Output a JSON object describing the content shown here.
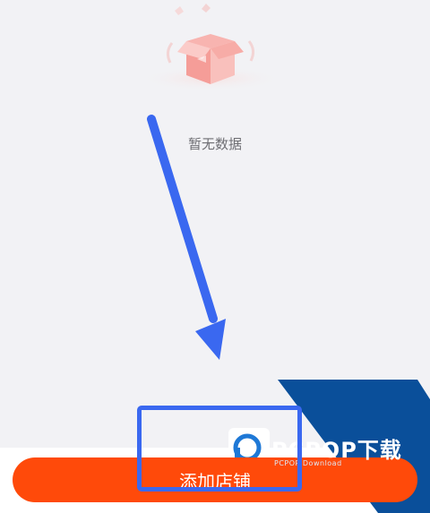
{
  "empty_state": {
    "text": "暂无数据",
    "illustration_icon": "empty-box-icon"
  },
  "actions": {
    "add_store_label": "添加店铺",
    "button_color": "#ff4a0a"
  },
  "annotation": {
    "arrow_color": "#3a68f0",
    "highlight_color": "#3a68f0"
  },
  "watermark": {
    "brand": "PCPOP下载",
    "sub": "PCPOP Download",
    "logo_color": "#0a4f9a"
  }
}
